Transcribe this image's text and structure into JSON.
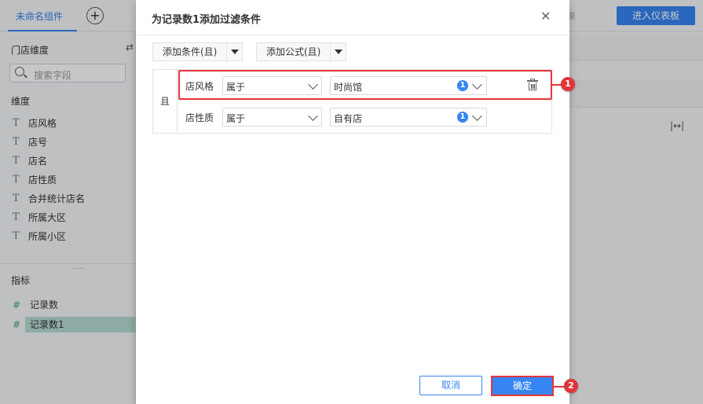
{
  "app": {
    "tab_title": "未命名组件",
    "add_tab_icon": "plus-circle-icon",
    "faint_label": "泉",
    "dashboard_button": "进入仪表板"
  },
  "left_panel": {
    "dimension_title": "门店维度",
    "search_placeholder": "搜索字段",
    "dimensions_header": "维度",
    "dimensions": [
      "店风格",
      "店号",
      "店名",
      "店性质",
      "合并统计店名",
      "所属大区",
      "所属小区"
    ],
    "metrics_header": "指标",
    "metrics": [
      "记录数",
      "记录数1"
    ]
  },
  "dialog": {
    "title": "为记录数1添加过滤条件",
    "add_condition_label": "添加条件(且)",
    "add_formula_label": "添加公式(且)",
    "logic_label": "且",
    "conditions": [
      {
        "field": "店风格",
        "operator": "属于",
        "value": "时尚馆",
        "count": "1"
      },
      {
        "field": "店性质",
        "operator": "属于",
        "value": "自有店",
        "count": "1"
      }
    ],
    "cancel_label": "取消",
    "ok_label": "确定"
  },
  "annotations": {
    "step1": "1",
    "step2": "2",
    "highlight_color": "#e5363a"
  },
  "colors": {
    "accent": "#3685f2",
    "badge": "#3685f2",
    "selected_row": "#b7dcd5"
  }
}
